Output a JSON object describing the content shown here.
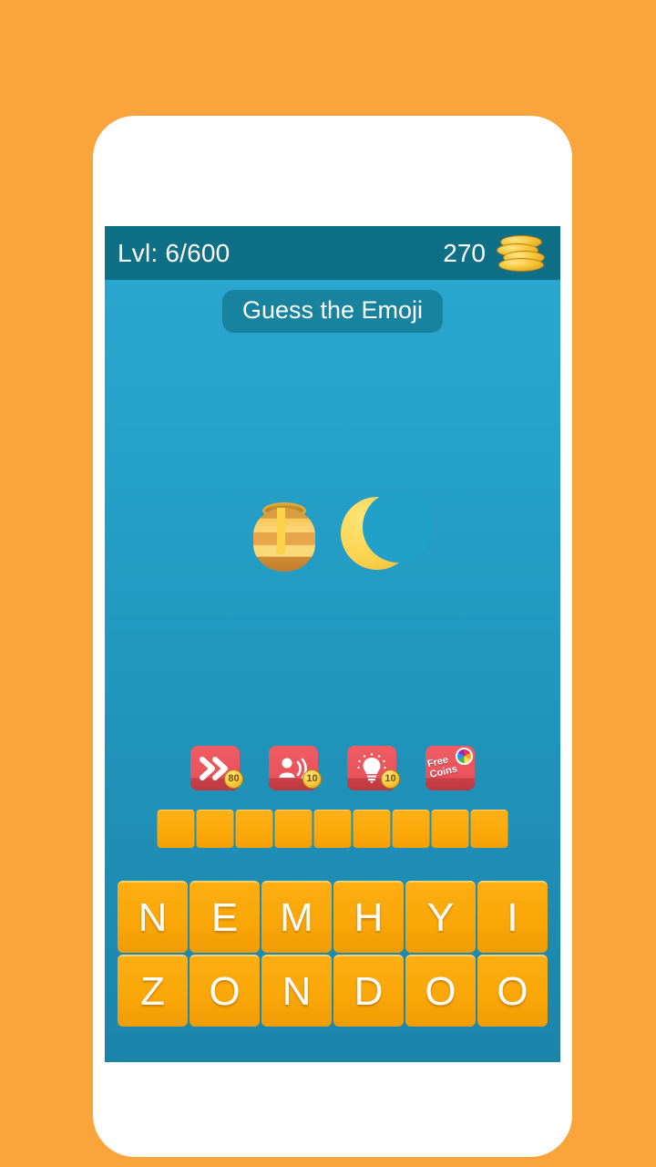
{
  "app": {
    "background_color": "#f9a53b",
    "screen_gradient_top": "#2ba7d1",
    "screen_gradient_bottom": "#1b84ab",
    "accent_orange": "#faa607",
    "header_color": "#0f6f87",
    "powerup_color": "#e9525a"
  },
  "header": {
    "level_label": "Lvl: 6/600",
    "coin_count": "270",
    "coin_icon": "coin-stack-icon"
  },
  "title": {
    "text": "Guess the Emoji"
  },
  "puzzle": {
    "emojis": [
      {
        "name": "honey-pot-emoji",
        "glyph": "🍯"
      },
      {
        "name": "crescent-moon-emoji",
        "glyph": "🌙"
      }
    ]
  },
  "powerups": [
    {
      "name": "skip-button",
      "icon": "double-chevron-right-icon",
      "cost": "80"
    },
    {
      "name": "ask-friend-button",
      "icon": "person-speaking-icon",
      "cost": "10"
    },
    {
      "name": "hint-button",
      "icon": "lightbulb-icon",
      "cost": "10"
    },
    {
      "name": "free-coins-button",
      "icon": "pinwheel-icon",
      "label_line1": "Free",
      "label_line2": "Coins"
    }
  ],
  "answer": {
    "slot_count": 9,
    "slots": [
      "",
      "",
      "",
      "",
      "",
      "",
      "",
      "",
      ""
    ]
  },
  "keyboard": {
    "rows": [
      [
        "N",
        "E",
        "M",
        "H",
        "Y",
        "I"
      ],
      [
        "Z",
        "O",
        "N",
        "D",
        "O",
        "O"
      ]
    ]
  }
}
